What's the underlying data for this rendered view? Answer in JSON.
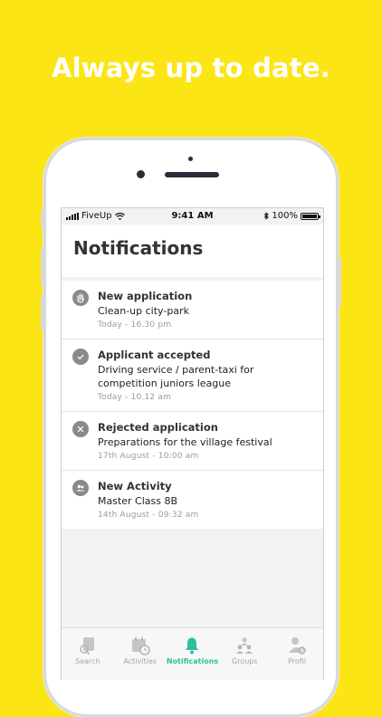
{
  "headline": "Always up to date.",
  "status_bar": {
    "carrier": "FiveUp",
    "time": "9:41 AM",
    "battery": "100%"
  },
  "page_title": "Notifications",
  "notifications": [
    {
      "icon": "hand-icon",
      "title": "New application",
      "description": "Clean-up city-park",
      "time": "Today - 16.30 pm"
    },
    {
      "icon": "check-icon",
      "title": "Applicant accepted",
      "description": "Driving service / parent-taxi for competition juniors league",
      "time": "Today - 10.12 am"
    },
    {
      "icon": "close-icon",
      "title": "Rejected application",
      "description": "Preparations for the village festival",
      "time": "17th August - 10:00 am"
    },
    {
      "icon": "group-icon",
      "title": "New Activity",
      "description": "Master Class 8B",
      "time": "14th August - 09:32 am"
    }
  ],
  "tabs": [
    {
      "label": "Search",
      "icon": "search-doc-icon"
    },
    {
      "label": "Activities",
      "icon": "calendar-clock-icon"
    },
    {
      "label": "Notifications",
      "icon": "bell-icon",
      "active": true
    },
    {
      "label": "Groups",
      "icon": "groups-icon"
    },
    {
      "label": "Profil",
      "icon": "profile-gear-icon"
    }
  ],
  "colors": {
    "background": "#FCE514",
    "accent": "#2DBF9C",
    "icon_grey": "#8A8A8A"
  }
}
